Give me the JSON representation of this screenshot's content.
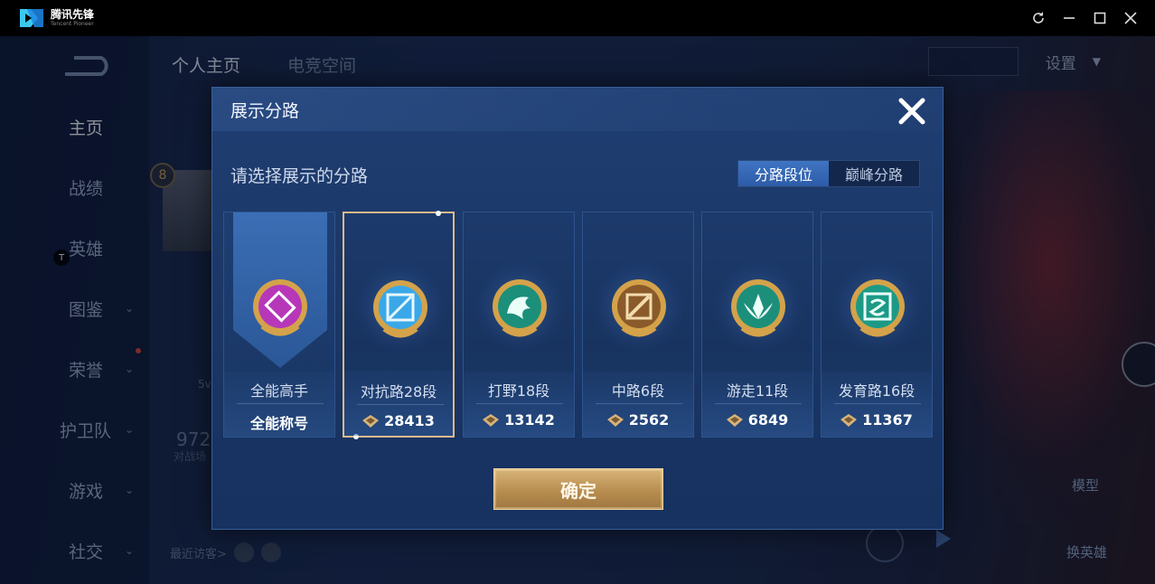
{
  "titlebar": {
    "app_name": "腾讯先锋",
    "app_name_en": "Tencent Pioneer",
    "buttons": [
      "refresh-icon",
      "minimize-icon",
      "maximize-icon",
      "close-icon"
    ]
  },
  "background": {
    "sidebar_items": [
      {
        "label": "主页",
        "active": true,
        "chevron": false
      },
      {
        "label": "战绩",
        "active": false,
        "chevron": false
      },
      {
        "label": "英雄",
        "active": false,
        "chevron": false
      },
      {
        "label": "图鉴",
        "active": false,
        "chevron": true
      },
      {
        "label": "荣誉",
        "active": false,
        "chevron": true
      },
      {
        "label": "护卫队",
        "active": false,
        "chevron": true
      },
      {
        "label": "游戏",
        "active": false,
        "chevron": true
      },
      {
        "label": "社交",
        "active": false,
        "chevron": true
      }
    ],
    "tabs": [
      "个人主页",
      "电竞空间"
    ],
    "settings_label": "设置",
    "level": "8",
    "stat_value": "972",
    "stat_label": "对战场",
    "sv_label": "5v",
    "visitors_label": "最近访客>",
    "t_badge": "T",
    "right_btn_1": "模型",
    "right_btn_2": "换英雄"
  },
  "modal": {
    "title": "展示分路",
    "subtitle": "请选择展示的分路",
    "toggle": [
      {
        "label": "分路段位",
        "active": true
      },
      {
        "label": "巅峰分路",
        "active": false
      }
    ],
    "cards": [
      {
        "name": "全能高手",
        "score": "全能称号",
        "has_score_icon": false,
        "selected": false,
        "emblem_color": "#b638b8",
        "emblem": "all-round-emblem-icon"
      },
      {
        "name": "对抗路28段",
        "score": "28413",
        "has_score_icon": true,
        "selected": true,
        "emblem_color": "#3aa8e8",
        "emblem": "clash-lane-emblem-icon"
      },
      {
        "name": "打野18段",
        "score": "13142",
        "has_score_icon": true,
        "selected": false,
        "emblem_color": "#1c8f7a",
        "emblem": "jungle-emblem-icon"
      },
      {
        "name": "中路6段",
        "score": "2562",
        "has_score_icon": true,
        "selected": false,
        "emblem_color": "#8a5a2a",
        "emblem": "mid-lane-emblem-icon"
      },
      {
        "name": "游走11段",
        "score": "6849",
        "has_score_icon": true,
        "selected": false,
        "emblem_color": "#1c8f7a",
        "emblem": "roam-emblem-icon"
      },
      {
        "name": "发育路16段",
        "score": "11367",
        "has_score_icon": true,
        "selected": false,
        "emblem_color": "#1c9a86",
        "emblem": "farm-lane-emblem-icon"
      }
    ],
    "confirm_label": "确定"
  },
  "colors": {
    "accent_gold": "#d8b57a",
    "toggle_active": "#3f74c2",
    "modal_bg": "#1f3e72"
  }
}
